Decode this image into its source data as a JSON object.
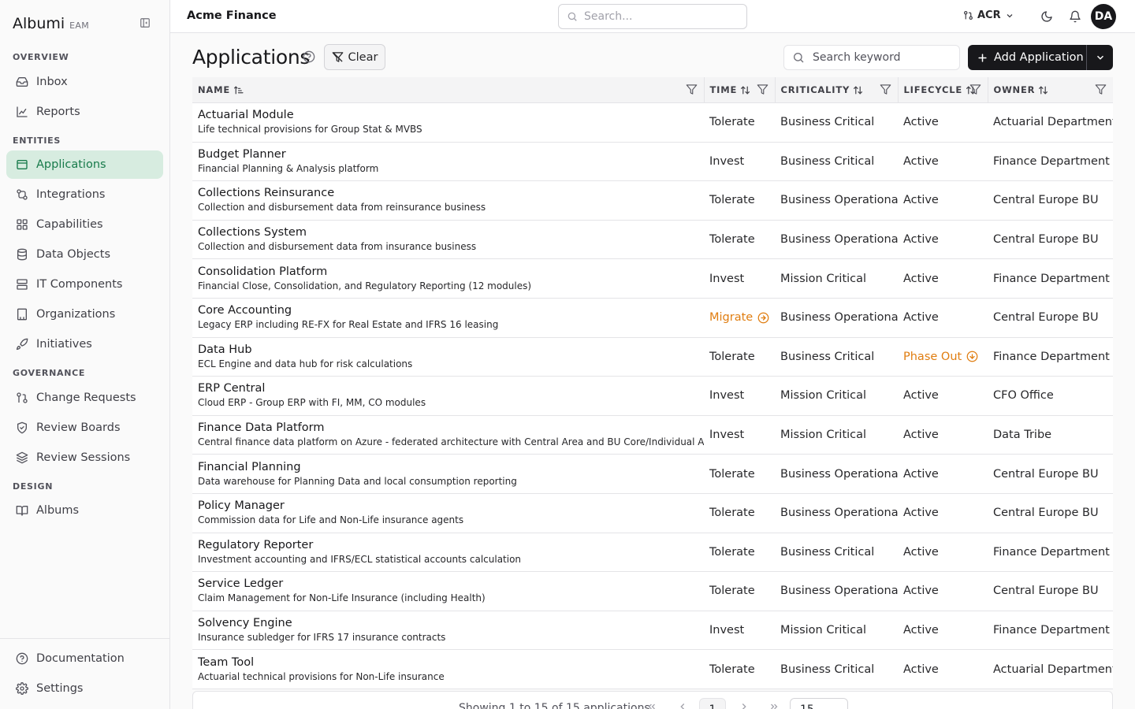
{
  "brand": {
    "name": "Albumi",
    "sub": "EAM"
  },
  "sidebar": {
    "groups": [
      {
        "label": "OVERVIEW"
      },
      {
        "label": "ENTITIES"
      },
      {
        "label": "GOVERNANCE"
      },
      {
        "label": "DESIGN"
      }
    ],
    "items": [
      {
        "label": "Inbox",
        "icon": "inbox-icon"
      },
      {
        "label": "Reports",
        "icon": "chart-icon"
      },
      {
        "label": "Applications",
        "icon": "window-icon",
        "active": true
      },
      {
        "label": "Integrations",
        "icon": "integration-icon"
      },
      {
        "label": "Capabilities",
        "icon": "blocks-icon"
      },
      {
        "label": "Data Objects",
        "icon": "database-icon"
      },
      {
        "label": "IT Components",
        "icon": "server-icon"
      },
      {
        "label": "Organizations",
        "icon": "building-icon"
      },
      {
        "label": "Initiatives",
        "icon": "rocket-icon"
      },
      {
        "label": "Change Requests",
        "icon": "pull-request-icon"
      },
      {
        "label": "Review Boards",
        "icon": "shield-check-icon"
      },
      {
        "label": "Review Sessions",
        "icon": "layers-icon"
      },
      {
        "label": "Albums",
        "icon": "book-icon"
      }
    ],
    "bottom": [
      {
        "label": "Documentation",
        "icon": "help-circle-icon"
      },
      {
        "label": "Settings",
        "icon": "gear-icon"
      }
    ]
  },
  "topbar": {
    "workspace": "Acme Finance",
    "search_placeholder": "Search...",
    "org_code": "ACR",
    "avatar_initials": "DA"
  },
  "page": {
    "title": "Applications",
    "clear_label": "Clear",
    "keyword_placeholder": "Search keyword",
    "add_label": "Add Application"
  },
  "table": {
    "columns": [
      {
        "label": "NAME"
      },
      {
        "label": "TIME"
      },
      {
        "label": "CRITICALITY"
      },
      {
        "label": "LIFECYCLE"
      },
      {
        "label": "OWNER"
      }
    ],
    "rows": [
      {
        "name": "Actuarial Module",
        "desc": "Life technical provisions for Group Stat & MVBS",
        "time": "Tolerate",
        "criticality": "Business Critical",
        "lifecycle": "Active",
        "owner": "Actuarial Department"
      },
      {
        "name": "Budget Planner",
        "desc": "Financial Planning & Analysis platform",
        "time": "Invest",
        "criticality": "Business Critical",
        "lifecycle": "Active",
        "owner": "Finance Department"
      },
      {
        "name": "Collections Reinsurance",
        "desc": "Collection and disbursement data from reinsurance business",
        "time": "Tolerate",
        "criticality": "Business Operational",
        "lifecycle": "Active",
        "owner": "Central Europe BU"
      },
      {
        "name": "Collections System",
        "desc": "Collection and disbursement data from insurance business",
        "time": "Tolerate",
        "criticality": "Business Operational",
        "lifecycle": "Active",
        "owner": "Central Europe BU"
      },
      {
        "name": "Consolidation Platform",
        "desc": "Financial Close, Consolidation, and Regulatory Reporting (12 modules)",
        "time": "Invest",
        "criticality": "Mission Critical",
        "lifecycle": "Active",
        "owner": "Finance Department"
      },
      {
        "name": "Core Accounting",
        "desc": "Legacy ERP including RE-FX for Real Estate and IFRS 16 leasing",
        "time": "Migrate",
        "time_warn": true,
        "criticality": "Business Operational",
        "lifecycle": "Active",
        "owner": "Central Europe BU"
      },
      {
        "name": "Data Hub",
        "desc": "ECL Engine and data hub for risk calculations",
        "time": "Tolerate",
        "criticality": "Business Critical",
        "lifecycle": "Phase Out",
        "lifecycle_warn": true,
        "owner": "Finance Department"
      },
      {
        "name": "ERP Central",
        "desc": "Cloud ERP - Group ERP with FI, MM, CO modules",
        "time": "Invest",
        "criticality": "Mission Critical",
        "lifecycle": "Active",
        "owner": "CFO Office"
      },
      {
        "name": "Finance Data Platform",
        "desc": "Central finance data platform on Azure - federated architecture with Central Area and BU Core/Individual Areas",
        "time": "Invest",
        "criticality": "Mission Critical",
        "lifecycle": "Active",
        "owner": "Data Tribe"
      },
      {
        "name": "Financial Planning",
        "desc": "Data warehouse for Planning Data and local consumption reporting",
        "time": "Tolerate",
        "criticality": "Business Operational",
        "lifecycle": "Active",
        "owner": "Central Europe BU"
      },
      {
        "name": "Policy Manager",
        "desc": "Commission data for Life and Non-Life insurance agents",
        "time": "Tolerate",
        "criticality": "Business Operational",
        "lifecycle": "Active",
        "owner": "Central Europe BU"
      },
      {
        "name": "Regulatory Reporter",
        "desc": "Investment accounting and IFRS/ECL statistical accounts calculation",
        "time": "Tolerate",
        "criticality": "Business Critical",
        "lifecycle": "Active",
        "owner": "Finance Department"
      },
      {
        "name": "Service Ledger",
        "desc": "Claim Management for Non-Life Insurance (including Health)",
        "time": "Tolerate",
        "criticality": "Business Operational",
        "lifecycle": "Active",
        "owner": "Central Europe BU"
      },
      {
        "name": "Solvency Engine",
        "desc": "Insurance subledger for IFRS 17 insurance contracts",
        "time": "Invest",
        "criticality": "Mission Critical",
        "lifecycle": "Active",
        "owner": "Finance Department"
      },
      {
        "name": "Team Tool",
        "desc": "Actuarial technical provisions for Non-Life insurance",
        "time": "Tolerate",
        "criticality": "Business Critical",
        "lifecycle": "Active",
        "owner": "Actuarial Department"
      }
    ]
  },
  "pagination": {
    "summary": "Showing 1 to 15 of 15 applications",
    "current_page": "1",
    "page_size": "15"
  },
  "colors": {
    "accent": "#177a4a",
    "accent_bg": "#d7ece0",
    "warning": "#e07d10",
    "primary_button": "#18181b"
  }
}
